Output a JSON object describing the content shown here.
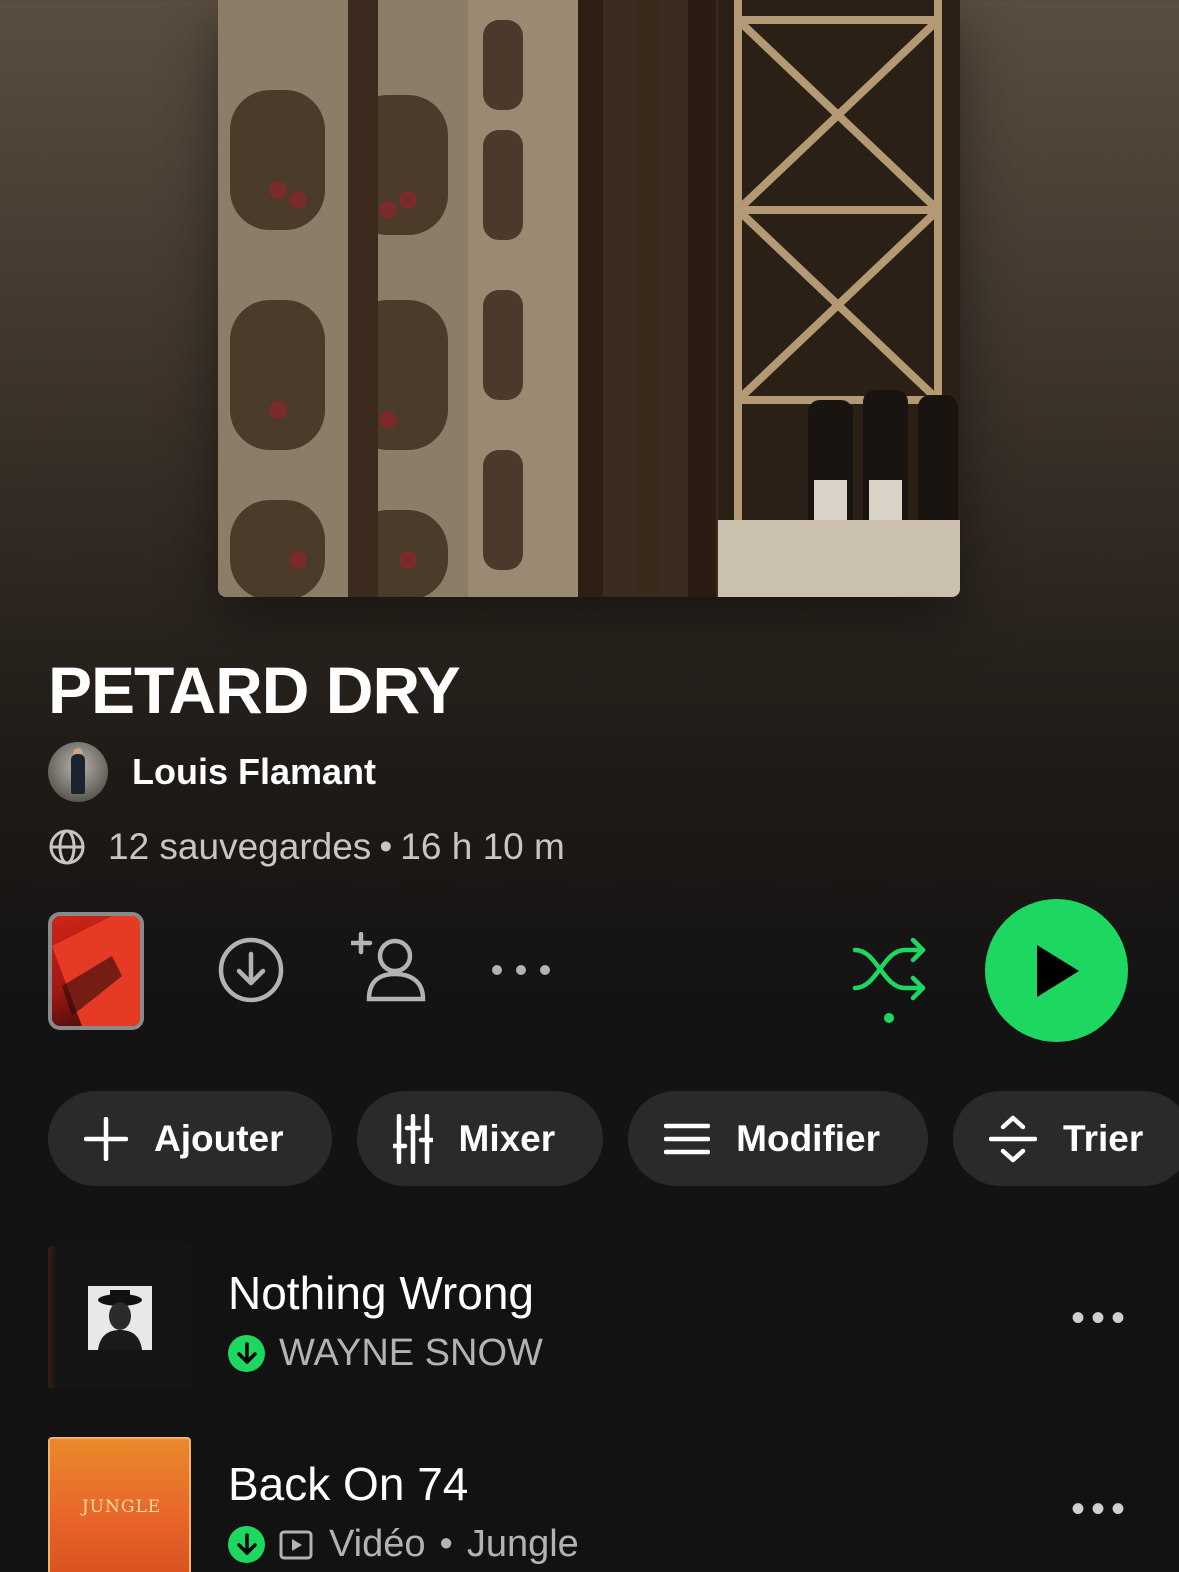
{
  "playlist": {
    "title": "PETARD DRY",
    "owner": "Louis Flamant",
    "saves": "12 sauvegardes",
    "separator": "•",
    "duration": "16 h 10 m"
  },
  "icons": {
    "globe": "globe-icon",
    "download": "download-circle-icon",
    "add_collaborator": "add-user-icon",
    "more": "more-horizontal-icon",
    "shuffle": "shuffle-icon",
    "play": "play-icon"
  },
  "colors": {
    "accent": "#1ed760",
    "chip_bg": "#2a2a2a",
    "background": "#121212"
  },
  "chips": [
    {
      "label": "Ajouter",
      "icon": "plus-icon"
    },
    {
      "label": "Mixer",
      "icon": "sliders-icon"
    },
    {
      "label": "Modifier",
      "icon": "menu-lines-icon"
    },
    {
      "label": "Trier",
      "icon": "sort-icon"
    }
  ],
  "tracks": [
    {
      "title": "Nothing Wrong",
      "artist": "WAYNE SNOW",
      "downloaded": true
    },
    {
      "title": "Back On 74",
      "type": "Vidéo",
      "artist": "Jungle",
      "downloaded": true,
      "cover_text": "JUNGLE"
    }
  ],
  "more_glyph": "•••"
}
